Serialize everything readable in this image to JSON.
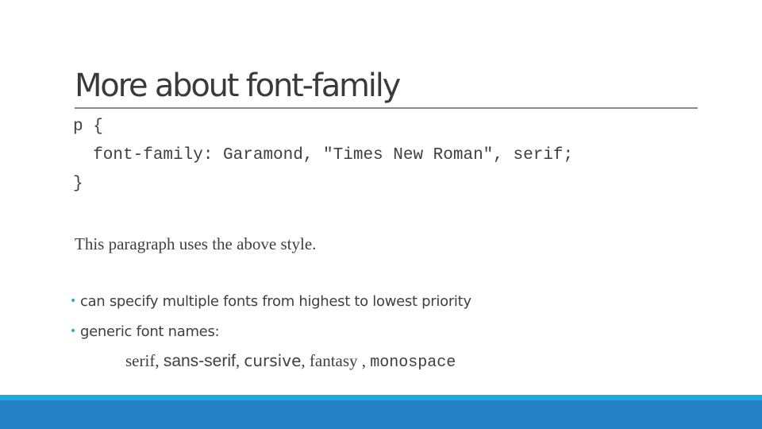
{
  "slide": {
    "title": "More about font-family",
    "code": {
      "line1": "p {",
      "line2": "  font-family: Garamond, \"Times New Roman\", serif;",
      "line3": "}"
    },
    "example_paragraph": "This paragraph uses the above style.",
    "bullets": [
      {
        "marker": "•",
        "text": "can specify multiple fonts from highest to lowest priority"
      },
      {
        "marker": "•",
        "text": "generic font names:"
      }
    ],
    "generic_fonts": {
      "serif": "serif",
      "sans_serif": "sans-serif",
      "cursive": "cursive",
      "fantasy": "fantasy",
      "monospace": "monospace",
      "sep": ", ",
      "sep_spaced": " , "
    }
  },
  "theme": {
    "accent_light": "#1fa9dc",
    "accent_dark": "#2682c6",
    "bullet_color": "#2ea4d8",
    "text_color": "#404040"
  }
}
